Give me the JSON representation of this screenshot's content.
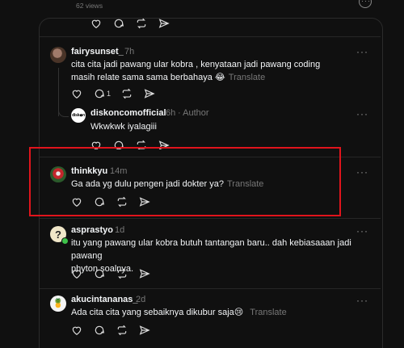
{
  "top": {
    "views": "62 views"
  },
  "comments": [
    {
      "username": "fairysunset_",
      "time": "7h",
      "text_line1": "cita cita jadi pawang ular kobra , kenyataan jadi pawang coding",
      "text_line2": "masih relate sama sama berbahaya 😂",
      "translate": "Translate",
      "reply_count": "1"
    },
    {
      "username": "diskoncomofficial",
      "time": "6h",
      "author_label": "· Author",
      "text": "Wkwkwk iyalagiii"
    },
    {
      "username": "thinkkyu",
      "time": "14m",
      "text": "Ga ada yg dulu pengen jadi dokter ya?",
      "translate": "Translate"
    },
    {
      "username": "asprastyo",
      "time": "1d",
      "text_line1": "itu yang pawang ular kobra butuh tantangan baru.. dah kebiasaaan jadi pawang",
      "text_line2": "phyton soalnya."
    },
    {
      "username": "akucintananas_",
      "time": "2d",
      "text": "Ada cita cita yang sebaiknya dikubur saja😢",
      "translate": "Translate"
    }
  ],
  "icons": {
    "like": "heart-icon",
    "reply": "comment-icon",
    "repost": "repost-icon",
    "share": "send-icon",
    "more": "more-icon"
  },
  "colors": {
    "highlight": "#e0141c",
    "background": "#101010"
  }
}
